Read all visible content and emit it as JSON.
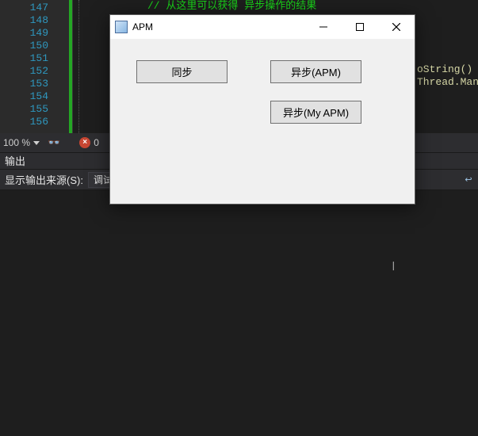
{
  "editor": {
    "line_numbers": [
      "147",
      "148",
      "149",
      "150",
      "151",
      "152",
      "153",
      "154",
      "155",
      "156"
    ],
    "comment_line": "// 从这里可以获得 异步操作的结果",
    "code_fragment_1": "oString() +",
    "code_fragment_2": "Thread.Manag"
  },
  "status": {
    "zoom": "100 %",
    "error_icon_glyph": "×",
    "error_count": "0"
  },
  "output": {
    "panel_title": "输出",
    "source_label": "显示输出来源(S):",
    "combo_value": "调试"
  },
  "apm": {
    "title": "APM",
    "buttons": {
      "sync": "同步",
      "async_apm": "异步(APM)",
      "async_my": "异步(My APM)"
    }
  }
}
